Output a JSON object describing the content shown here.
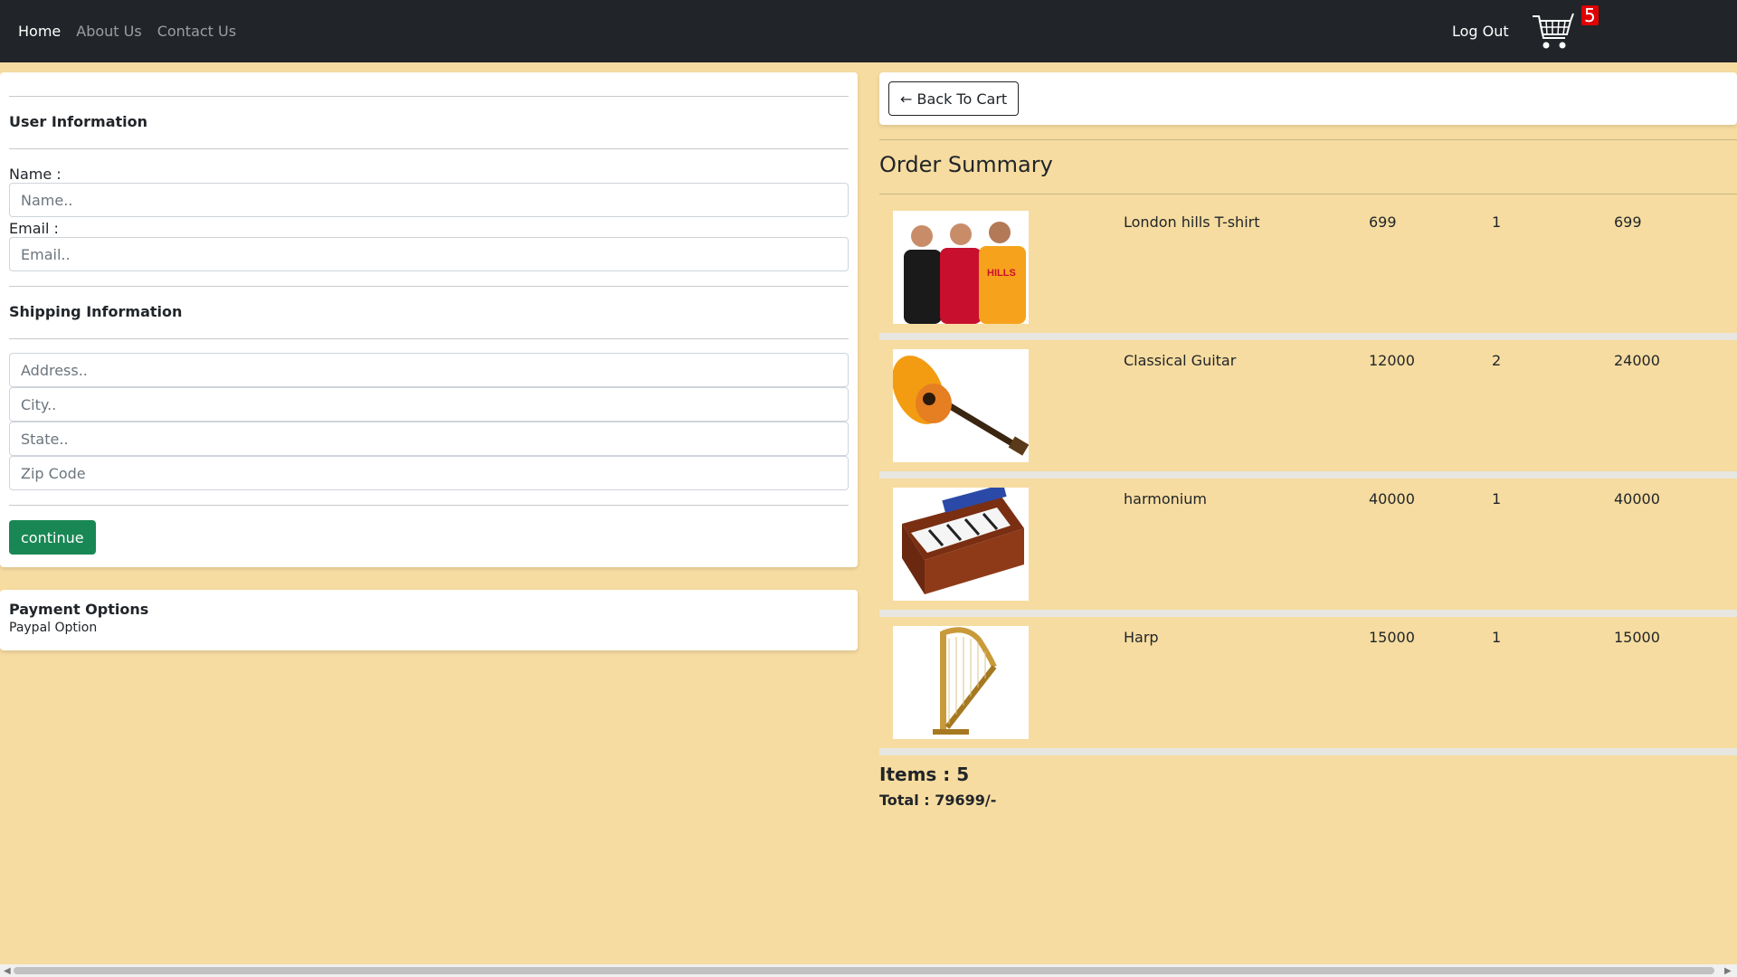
{
  "nav": {
    "links": [
      "Home",
      "About Us",
      "Contact Us"
    ],
    "logout": "Log Out",
    "cart_count": "5"
  },
  "form": {
    "user_section_title": "User Information",
    "name_label": "Name :",
    "name_placeholder": "Name..",
    "email_label": "Email :",
    "email_placeholder": "Email..",
    "shipping_section_title": "Shipping Information",
    "address_placeholder": "Address..",
    "city_placeholder": "City..",
    "state_placeholder": "State..",
    "zip_placeholder": "Zip Code",
    "continue_label": "continue"
  },
  "payment": {
    "title": "Payment Options",
    "option": "Paypal Option"
  },
  "summary": {
    "back_label": "← Back To Cart",
    "title": "Order Summary",
    "items": [
      {
        "name": "London hills T-shirt",
        "price": "699",
        "qty": "1",
        "total": "699",
        "image_icon": "tshirt-image"
      },
      {
        "name": "Classical Guitar",
        "price": "12000",
        "qty": "2",
        "total": "24000",
        "image_icon": "guitar-image"
      },
      {
        "name": "harmonium",
        "price": "40000",
        "qty": "1",
        "total": "40000",
        "image_icon": "harmonium-image"
      },
      {
        "name": "Harp",
        "price": "15000",
        "qty": "1",
        "total": "15000",
        "image_icon": "harp-image"
      }
    ],
    "items_text": "Items : 5",
    "total_text": "Total : 79699/-"
  }
}
